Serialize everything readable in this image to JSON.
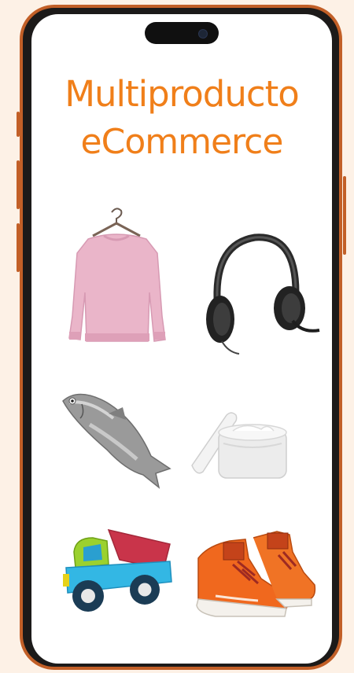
{
  "page": {
    "title_line1": "Multiproducto",
    "title_line2": "eCommerce",
    "accent_color": "#f07f1a",
    "frame_color": "#c25f27"
  },
  "products": [
    {
      "name": "sweatshirt-on-hanger",
      "icon": "sweatshirt-icon"
    },
    {
      "name": "headset",
      "icon": "headset-icon"
    },
    {
      "name": "fish",
      "icon": "fish-icon"
    },
    {
      "name": "cream-jar",
      "icon": "cream-jar-icon"
    },
    {
      "name": "toy-truck",
      "icon": "toy-truck-icon"
    },
    {
      "name": "sneakers",
      "icon": "sneakers-icon"
    }
  ]
}
